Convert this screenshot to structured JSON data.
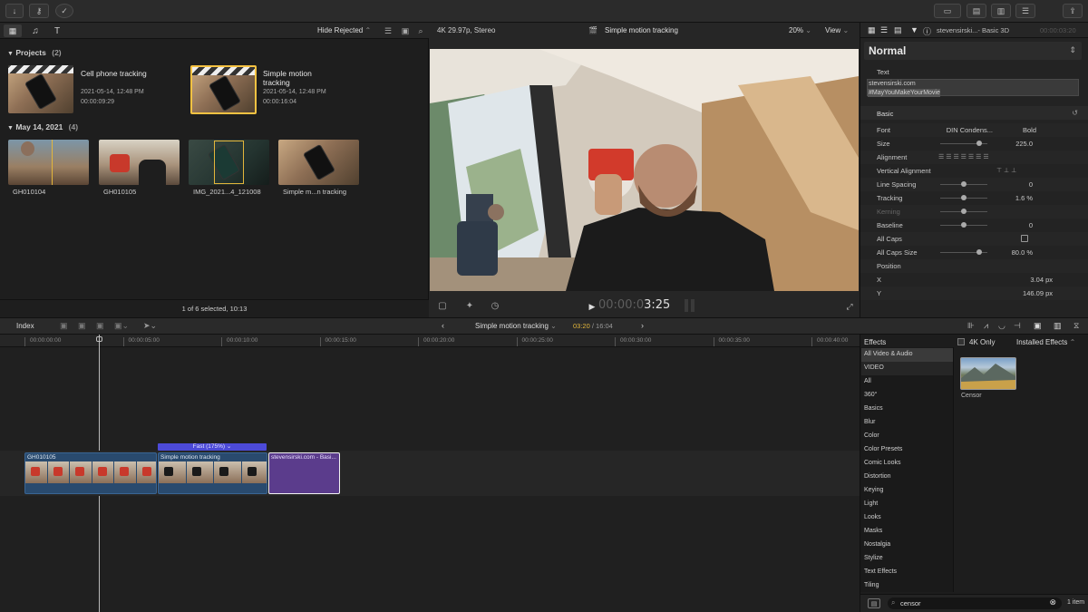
{
  "browser": {
    "hide_rejected": "Hide Rejected",
    "projects_header": "Projects",
    "projects_count": "(2)",
    "projects": [
      {
        "title": "Cell phone tracking",
        "date": "2021-05-14, 12:48 PM",
        "duration": "00:00:09:29"
      },
      {
        "title": "Simple motion tracking",
        "date": "2021-05-14, 12:48 PM",
        "duration": "00:00:16:04"
      }
    ],
    "event_header": "May 14, 2021",
    "event_count": "(4)",
    "clips": [
      "GH010104",
      "GH010105",
      "IMG_2021...4_121008",
      "Simple m...n tracking"
    ],
    "status": "1 of 6 selected, 10:13"
  },
  "viewer": {
    "format": "4K 29.97p, Stereo",
    "title": "Simple motion tracking",
    "zoom": "20%",
    "view_menu": "View",
    "timecode_dim": "00:00:0",
    "timecode_bright": "3:25"
  },
  "inspector": {
    "clip_name": "stevensirski...- Basic 3D",
    "clip_time": "00:00:03:20",
    "preset": "Normal",
    "text_label": "Text",
    "text_line1": "stevensirski.com",
    "text_line2": "#MayYouMakeYourMovie",
    "basic_label": "Basic",
    "rows": [
      {
        "label": "Font",
        "value": "DIN Condens...",
        "value2": "Bold"
      },
      {
        "label": "Size",
        "value": "225.0"
      },
      {
        "label": "Alignment",
        "value": ""
      },
      {
        "label": "Vertical Alignment",
        "value": ""
      },
      {
        "label": "Line Spacing",
        "value": "0"
      },
      {
        "label": "Tracking",
        "value": "1.6 %"
      },
      {
        "label": "Kerning",
        "value": ""
      },
      {
        "label": "Baseline",
        "value": "0"
      },
      {
        "label": "All Caps",
        "value": ""
      },
      {
        "label": "All Caps Size",
        "value": "80.0 %"
      },
      {
        "label": "Position",
        "value": ""
      },
      {
        "label": "X",
        "value": "3.04 px"
      },
      {
        "label": "Y",
        "value": "146.09 px"
      }
    ]
  },
  "timeline": {
    "index_label": "Index",
    "project_name": "Simple motion tracking",
    "time_current": "03:20",
    "time_total": "/ 16:04",
    "ruler": [
      "00:00:00:00",
      "00:00:05:00",
      "00:00:10:00",
      "00:00:15:00",
      "00:00:20:00",
      "00:00:25:00",
      "00:00:30:00",
      "00:00:35:00",
      "00:00:40:00"
    ],
    "speed_label": "Fast (175%)",
    "clip1": "GH010105",
    "clip2": "Simple motion tracking",
    "clip3": "stevensirski.com - Basi..."
  },
  "effects": {
    "header": "Effects",
    "four_k_only": "4K Only",
    "installed": "Installed Effects",
    "categories": [
      "All Video & Audio",
      "VIDEO",
      "All",
      "360°",
      "Basics",
      "Blur",
      "Color",
      "Color Presets",
      "Comic Looks",
      "Distortion",
      "Keying",
      "Light",
      "Looks",
      "Masks",
      "Nostalgia",
      "Stylize",
      "Text Effects",
      "Tiling"
    ],
    "result_name": "Censor",
    "search_value": "censor",
    "item_count": "1 item"
  },
  "colors": {
    "accent": "#e3b63b",
    "selection": "#f5c242",
    "title_clip": "#5b3c8c",
    "speed_bar": "#4c4ad8"
  }
}
